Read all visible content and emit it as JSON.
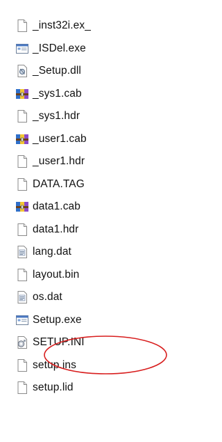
{
  "files": [
    {
      "name": "_inst32i.ex_",
      "icon": "blank-file-icon"
    },
    {
      "name": "_ISDel.exe",
      "icon": "exe-window-icon"
    },
    {
      "name": "_Setup.dll",
      "icon": "dll-gear-icon"
    },
    {
      "name": "_sys1.cab",
      "icon": "cab-archive-icon"
    },
    {
      "name": "_sys1.hdr",
      "icon": "blank-file-icon"
    },
    {
      "name": "_user1.cab",
      "icon": "cab-archive-icon"
    },
    {
      "name": "_user1.hdr",
      "icon": "blank-file-icon"
    },
    {
      "name": "DATA.TAG",
      "icon": "blank-file-icon"
    },
    {
      "name": "data1.cab",
      "icon": "cab-archive-icon"
    },
    {
      "name": "data1.hdr",
      "icon": "blank-file-icon"
    },
    {
      "name": "lang.dat",
      "icon": "dat-file-icon"
    },
    {
      "name": "layout.bin",
      "icon": "blank-file-icon"
    },
    {
      "name": "os.dat",
      "icon": "dat-file-icon"
    },
    {
      "name": "Setup.exe",
      "icon": "exe-window-icon",
      "highlighted": true
    },
    {
      "name": "SETUP.INI",
      "icon": "ini-settings-icon"
    },
    {
      "name": "setup.ins",
      "icon": "blank-file-icon"
    },
    {
      "name": "setup.lid",
      "icon": "blank-file-icon"
    }
  ],
  "colors": {
    "highlight_circle": "#d81e1e",
    "archive_yellow": "#f2c533",
    "archive_blue": "#2f6fc9",
    "archive_purple": "#8a4ac8"
  }
}
